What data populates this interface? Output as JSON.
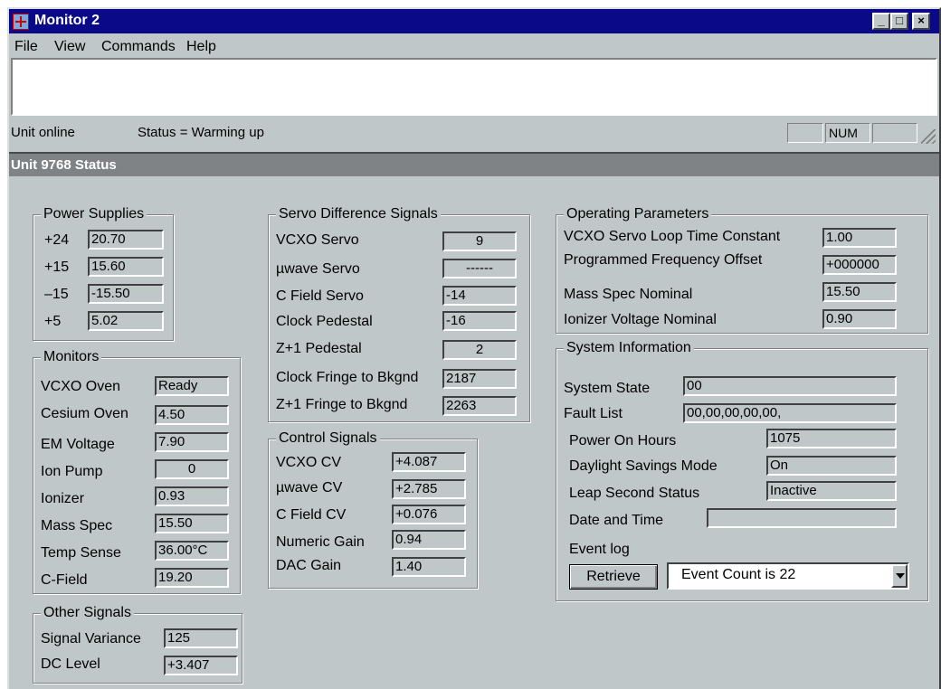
{
  "window": {
    "title": "Monitor 2"
  },
  "menu": {
    "file": "File",
    "view": "View",
    "commands": "Commands",
    "help": "Help"
  },
  "statusbar": {
    "left": "Unit online",
    "status": "Status = Warming up",
    "num": "NUM"
  },
  "unit_header": "Unit 9768 Status",
  "power": {
    "title": "Power Supplies",
    "rows": [
      {
        "label": "+24",
        "value": "20.70"
      },
      {
        "label": "+15",
        "value": "15.60"
      },
      {
        "label": "–15",
        "value": "-15.50"
      },
      {
        "label": "+5",
        "value": "5.02"
      }
    ]
  },
  "monitors": {
    "title": "Monitors",
    "rows": [
      {
        "label": "VCXO Oven",
        "value": "Ready"
      },
      {
        "label": "Cesium Oven",
        "value": "4.50"
      },
      {
        "label": "EM Voltage",
        "value": "7.90"
      },
      {
        "label": "Ion Pump",
        "value": "0"
      },
      {
        "label": "Ionizer",
        "value": "0.93"
      },
      {
        "label": "Mass Spec",
        "value": "15.50"
      },
      {
        "label": "Temp Sense",
        "value": "36.00°C"
      },
      {
        "label": "C-Field",
        "value": "19.20"
      }
    ]
  },
  "other": {
    "title": "Other Signals",
    "rows": [
      {
        "label": "Signal Variance",
        "value": "125"
      },
      {
        "label": "DC Level",
        "value": "+3.407"
      }
    ]
  },
  "servo": {
    "title": "Servo Difference Signals",
    "rows": [
      {
        "label": "VCXO Servo",
        "value": "9"
      },
      {
        "label": "µwave Servo",
        "value": "------"
      },
      {
        "label": "C Field Servo",
        "value": "-14"
      },
      {
        "label": "Clock Pedestal",
        "value": "-16"
      },
      {
        "label": "Z+1 Pedestal",
        "value": "2"
      },
      {
        "label": "Clock Fringe to Bkgnd",
        "value": "2187"
      },
      {
        "label": "Z+1 Fringe to Bkgnd",
        "value": "2263"
      }
    ]
  },
  "control": {
    "title": "Control Signals",
    "rows": [
      {
        "label": "VCXO CV",
        "value": "+4.087"
      },
      {
        "label": "µwave CV",
        "value": "+2.785"
      },
      {
        "label": "C Field CV",
        "value": "+0.076"
      },
      {
        "label": "Numeric Gain",
        "value": "0.94"
      },
      {
        "label": "DAC Gain",
        "value": "1.40"
      }
    ]
  },
  "operating": {
    "title": "Operating Parameters",
    "rows": [
      {
        "label": "VCXO Servo Loop Time Constant",
        "value": "1.00"
      },
      {
        "label": "Programmed Frequency Offset",
        "value": "+000000"
      },
      {
        "label": "Mass Spec Nominal",
        "value": "15.50"
      },
      {
        "label": "Ionizer Voltage Nominal",
        "value": "0.90"
      }
    ]
  },
  "system": {
    "title": "System Information",
    "system_state": {
      "label": "System State",
      "value": "00"
    },
    "fault_list": {
      "label": "Fault List",
      "value": "00,00,00,00,00,"
    },
    "power_on_hours": {
      "label": "Power On Hours",
      "value": "1075"
    },
    "daylight": {
      "label": "Daylight Savings Mode",
      "value": "On"
    },
    "leap": {
      "label": "Leap Second Status",
      "value": "Inactive"
    },
    "datetime": {
      "label": "Date and Time",
      "value": ""
    },
    "event_log_label": "Event log",
    "retrieve_label": "Retrieve",
    "event_count": "Event Count is 22"
  }
}
